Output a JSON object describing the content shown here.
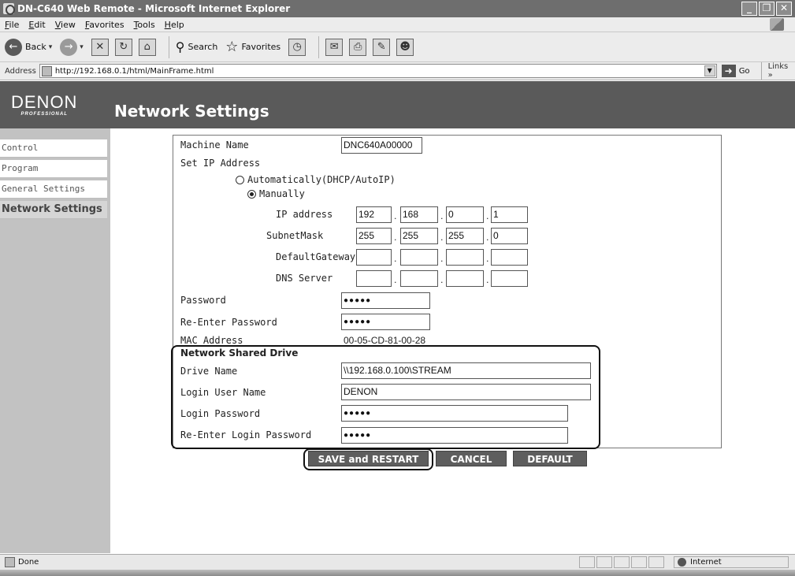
{
  "window": {
    "title": "DN-C640 Web Remote - Microsoft Internet Explorer"
  },
  "menu": [
    "File",
    "Edit",
    "View",
    "Favorites",
    "Tools",
    "Help"
  ],
  "toolbar": {
    "back": "Back",
    "search": "Search",
    "favorites": "Favorites"
  },
  "address": {
    "label": "Address",
    "url": "http://192.168.0.1/html/MainFrame.html",
    "go": "Go",
    "links": "Links"
  },
  "header": {
    "logo": "DENON",
    "logo_sub": "PROFESSIONAL",
    "title": "Network Settings"
  },
  "sidebar": {
    "items": [
      {
        "label": "Control"
      },
      {
        "label": "Program"
      },
      {
        "label": "General Settings"
      },
      {
        "label": "Network Settings"
      }
    ]
  },
  "form": {
    "machine_name": {
      "label": "Machine Name",
      "value": "DNC640A00000"
    },
    "set_ip": {
      "label": "Set IP Address",
      "auto": "Automatically(DHCP/AutoIP)",
      "manual": "Manually",
      "selected": "manual"
    },
    "ip_address": {
      "label": "IP address",
      "values": [
        "192",
        "168",
        "0",
        "1"
      ]
    },
    "subnet_mask": {
      "label": "SubnetMask",
      "values": [
        "255",
        "255",
        "255",
        "0"
      ]
    },
    "default_gateway": {
      "label": "DefaultGateway",
      "values": [
        "",
        "",
        "",
        ""
      ]
    },
    "dns_server": {
      "label": "DNS Server",
      "values": [
        "",
        "",
        "",
        ""
      ]
    },
    "password": {
      "label": "Password",
      "value": "●●●●●"
    },
    "reenter_password": {
      "label": "Re-Enter Password",
      "value": "●●●●●"
    },
    "mac_address": {
      "label": "MAC Address",
      "value": "00-05-CD-81-00-28"
    },
    "shared_drive": {
      "heading": "Network Shared Drive",
      "drive_name": {
        "label": "Drive Name",
        "value": "\\\\192.168.0.100\\STREAM"
      },
      "login_user": {
        "label": "Login User Name",
        "value": "DENON"
      },
      "login_password": {
        "label": "Login Password",
        "value": "●●●●●"
      },
      "reenter_login_password": {
        "label": "Re-Enter Login Password",
        "value": "●●●●●"
      }
    }
  },
  "buttons": {
    "save": "SAVE and RESTART",
    "cancel": "CANCEL",
    "default": "DEFAULT"
  },
  "status": {
    "text": "Done",
    "zone": "Internet"
  }
}
